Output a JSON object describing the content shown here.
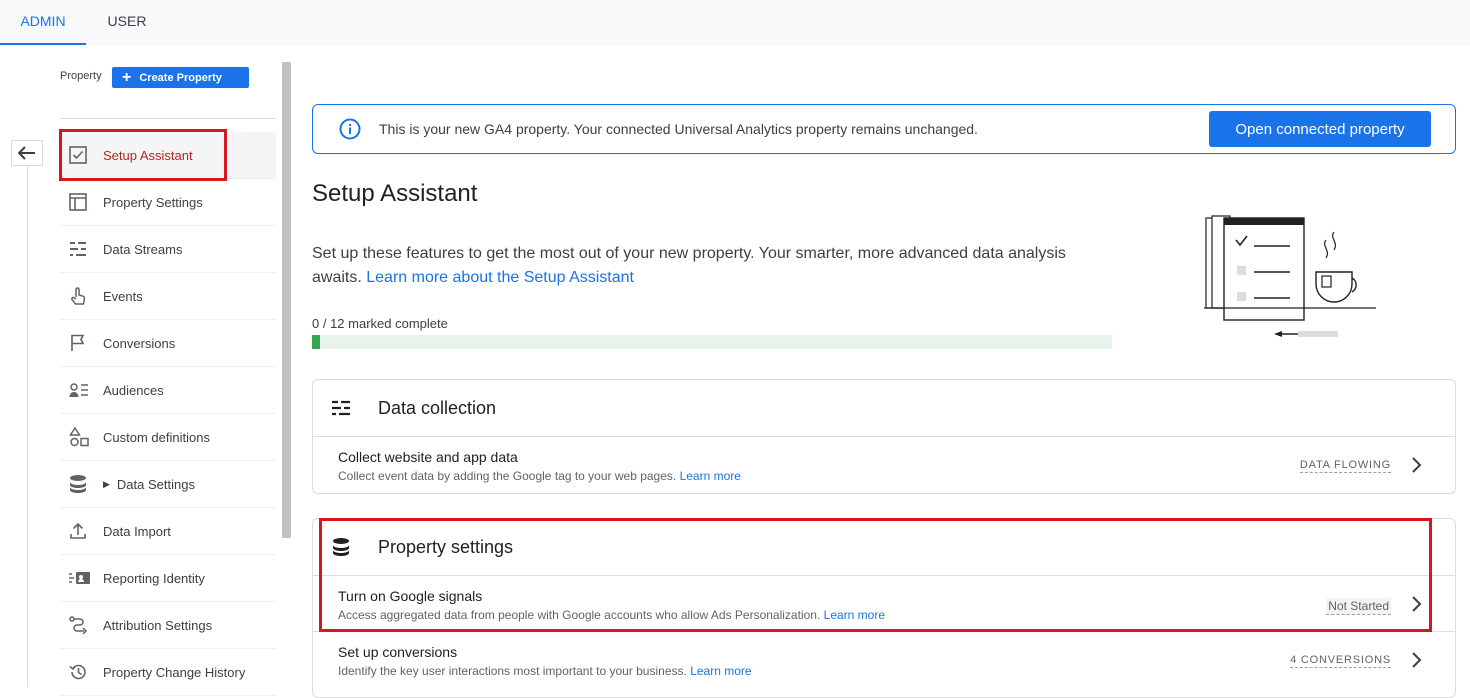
{
  "top_tabs": {
    "admin": "ADMIN",
    "user": "USER"
  },
  "sidebar": {
    "property_label": "Property",
    "create_property": "Create Property",
    "items": [
      {
        "label": "Setup Assistant",
        "icon": "checkbox-icon"
      },
      {
        "label": "Property Settings",
        "icon": "layout-icon"
      },
      {
        "label": "Data Streams",
        "icon": "streams-icon"
      },
      {
        "label": "Events",
        "icon": "touch-icon"
      },
      {
        "label": "Conversions",
        "icon": "flag-icon"
      },
      {
        "label": "Audiences",
        "icon": "audience-icon"
      },
      {
        "label": "Custom definitions",
        "icon": "shapes-icon"
      },
      {
        "label": "Data Settings",
        "icon": "database-icon"
      },
      {
        "label": "Data Import",
        "icon": "upload-icon"
      },
      {
        "label": "Reporting Identity",
        "icon": "identity-icon"
      },
      {
        "label": "Attribution Settings",
        "icon": "attribution-icon"
      },
      {
        "label": "Property Change History",
        "icon": "history-icon"
      }
    ]
  },
  "banner": {
    "message": "This is your new GA4 property. Your connected Universal Analytics property remains unchanged.",
    "button": "Open connected property"
  },
  "main": {
    "title": "Setup Assistant",
    "intro": "Set up these features to get the most out of your new property. Your smarter, more advanced data analysis awaits.",
    "intro_link": "Learn more about the Setup Assistant",
    "progress_label": "0 / 12 marked complete",
    "progress_fraction": 0.01
  },
  "data_collection": {
    "title": "Data collection",
    "rows": [
      {
        "title": "Collect website and app data",
        "desc": "Collect event data by adding the Google tag to your web pages.",
        "link": "Learn more",
        "status": "DATA FLOWING"
      }
    ]
  },
  "property_settings": {
    "title": "Property settings",
    "rows": [
      {
        "title": "Turn on Google signals",
        "desc": "Access aggregated data from people with Google accounts who allow Ads Personalization.",
        "link": "Learn more",
        "status": "Not Started"
      },
      {
        "title": "Set up conversions",
        "desc": "Identify the key user interactions most important to your business.",
        "link": "Learn more",
        "status": "4 CONVERSIONS"
      }
    ]
  },
  "colors": {
    "accent": "#1a73e8",
    "highlight": "#d3191f",
    "progress": "#34a853"
  }
}
